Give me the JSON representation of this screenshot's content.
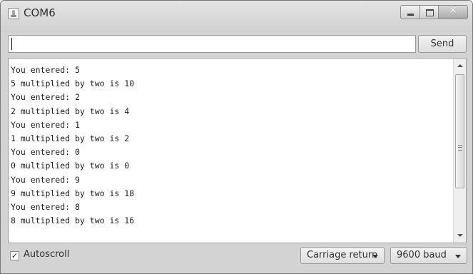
{
  "window": {
    "title": "COM6",
    "icon": "arduino-app-icon",
    "controls": [
      "minimize-icon",
      "maximize-icon",
      "close-icon"
    ],
    "close_symbol": "✕"
  },
  "input": {
    "value": "",
    "send_label": "Send"
  },
  "output": {
    "lines": [
      "You entered: 5",
      "5 multiplied by two is 10",
      "You entered: 2",
      "2 multiplied by two is 4",
      "You entered: 1",
      "1 multiplied by two is 2",
      "You entered: 0",
      "0 multiplied by two is 0",
      "You entered: 9",
      "9 multiplied by two is 18",
      "You entered: 8",
      "8 multiplied by two is 16"
    ]
  },
  "footer": {
    "autoscroll_label": "Autoscroll",
    "autoscroll_checked": true,
    "check_mark": "✓",
    "line_ending": "Carriage return",
    "baud_rate": "9600 baud"
  }
}
